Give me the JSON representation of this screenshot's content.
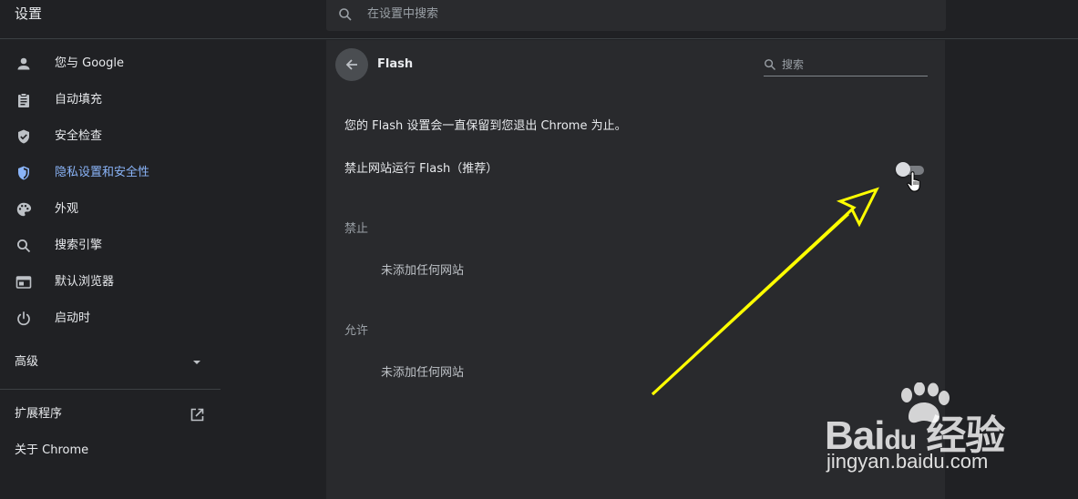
{
  "app": {
    "title": "设置"
  },
  "search": {
    "placeholder": "在设置中搜索"
  },
  "sidebar": {
    "items": [
      {
        "label": "您与 Google",
        "icon": "person-icon"
      },
      {
        "label": "自动填充",
        "icon": "clipboard-icon"
      },
      {
        "label": "安全检查",
        "icon": "shield-check-icon"
      },
      {
        "label": "隐私设置和安全性",
        "icon": "privacy-shield-icon",
        "active": true
      },
      {
        "label": "外观",
        "icon": "palette-icon"
      },
      {
        "label": "搜索引擎",
        "icon": "search-icon"
      },
      {
        "label": "默认浏览器",
        "icon": "browser-icon"
      },
      {
        "label": "启动时",
        "icon": "power-icon"
      }
    ],
    "advanced_label": "高级",
    "extensions_label": "扩展程序",
    "about_label": "关于 Chrome"
  },
  "page": {
    "title": "Flash",
    "search_placeholder": "搜索",
    "info": "您的 Flash 设置会一直保留到您退出 Chrome 为止。",
    "toggle_label": "禁止网站运行 Flash（推荐）",
    "toggle_state": "off",
    "block_heading": "禁止",
    "block_empty": "未添加任何网站",
    "allow_heading": "允许",
    "allow_empty": "未添加任何网站"
  },
  "watermark": {
    "logo_text": "Bai du 经验",
    "url": "jingyan.baidu.com"
  },
  "colors": {
    "background": "#202124",
    "card": "#292a2d",
    "accent": "#8ab4f8",
    "annotation": "#ffff00"
  }
}
